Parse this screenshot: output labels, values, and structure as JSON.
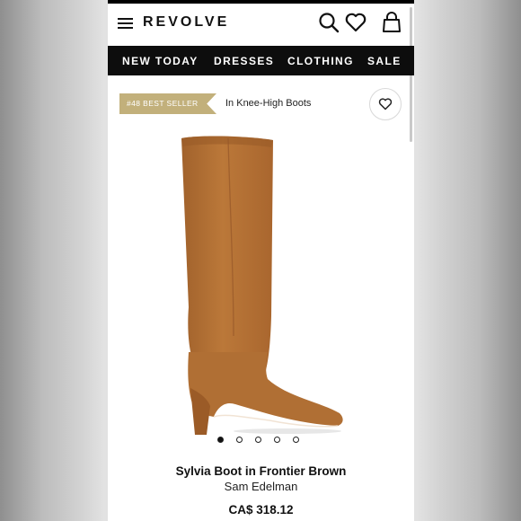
{
  "header": {
    "logo": "REVOLVE",
    "icons": [
      "menu-icon",
      "search-icon",
      "heart-icon",
      "bag-icon"
    ]
  },
  "nav": {
    "items": [
      "NEW TODAY",
      "DRESSES",
      "CLOTHING",
      "SALE"
    ]
  },
  "badge": {
    "text": "#48 BEST SELLER",
    "category": "In Knee-High Boots"
  },
  "carousel": {
    "total": 5,
    "active": 1
  },
  "product": {
    "title": "Sylvia Boot in Frontier Brown",
    "brand": "Sam Edelman",
    "price": "CA$ 318.12"
  },
  "colors": {
    "badge": "#c2b07b",
    "nav_bg": "#0d0d0d",
    "boot": "#b26e33"
  }
}
